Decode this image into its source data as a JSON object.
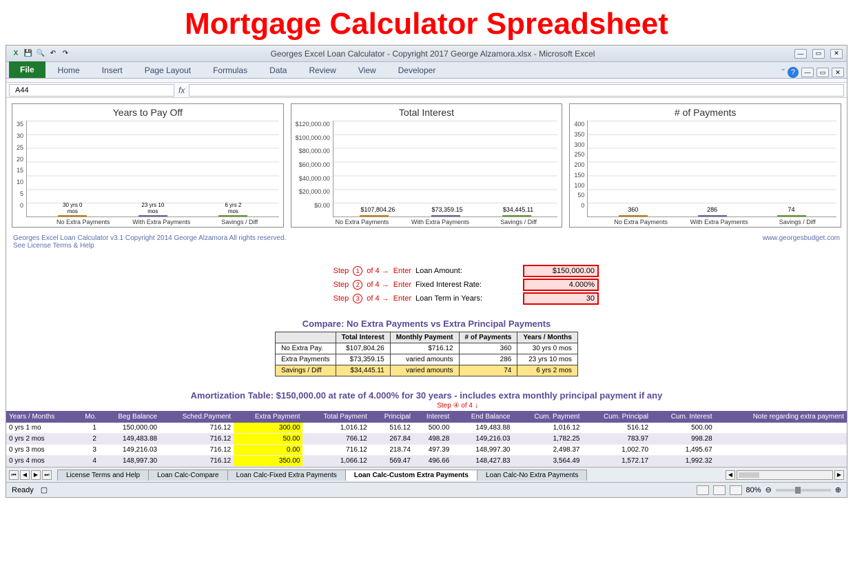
{
  "page_heading": "Mortgage Calculator Spreadsheet",
  "window_title": "Georges Excel Loan Calculator -  Copyright 2017 George Alzamora.xlsx  -  Microsoft Excel",
  "ribbon": {
    "file": "File",
    "tabs": [
      "Home",
      "Insert",
      "Page Layout",
      "Formulas",
      "Data",
      "Review",
      "View",
      "Developer"
    ]
  },
  "namebox": "A44",
  "fx": "fx",
  "credits_left": "Georges Excel Loan Calculator v3.1   Copyright 2014 George Alzamora  All rights reserved.",
  "credits_left2": "See License Terms & Help",
  "credits_right": "www.georgesbudget.com",
  "chart_data": [
    {
      "type": "bar",
      "title": "Years to Pay Off",
      "categories": [
        "No Extra Payments",
        "With Extra Payments",
        "Savings / Diff"
      ],
      "values": [
        30,
        23.83,
        6.17
      ],
      "bar_labels": [
        "30 yrs 0 mos",
        "23 yrs 10 mos",
        "6 yrs 2 mos"
      ],
      "ylim": [
        0,
        35
      ],
      "yticks": [
        "35",
        "30",
        "25",
        "20",
        "15",
        "10",
        "5",
        "0"
      ]
    },
    {
      "type": "bar",
      "title": "Total Interest",
      "categories": [
        "No Extra Payments",
        "With Extra Payments",
        "Savings / Diff"
      ],
      "values": [
        107804.26,
        73359.15,
        34445.11
      ],
      "bar_labels": [
        "$107,804.26",
        "$73,359.15",
        "$34,445.11"
      ],
      "ylim": [
        0,
        120000
      ],
      "yticks": [
        "$120,000.00",
        "$100,000.00",
        "$80,000.00",
        "$60,000.00",
        "$40,000.00",
        "$20,000.00",
        "$0.00"
      ]
    },
    {
      "type": "bar",
      "title": "# of Payments",
      "categories": [
        "No Extra Payments",
        "With Extra Payments",
        "Savings / Diff"
      ],
      "values": [
        360,
        286,
        74
      ],
      "bar_labels": [
        "360",
        "286",
        "74"
      ],
      "ylim": [
        0,
        400
      ],
      "yticks": [
        "400",
        "350",
        "300",
        "250",
        "200",
        "150",
        "100",
        "50",
        "0"
      ]
    }
  ],
  "steps": {
    "prefix": "Step",
    "of": "of 4 →",
    "enter": "Enter",
    "rows": [
      {
        "num": "1",
        "label": "Loan Amount:",
        "value": "$150,000.00"
      },
      {
        "num": "2",
        "label": "Fixed Interest Rate:",
        "value": "4.000%"
      },
      {
        "num": "3",
        "label": "Loan Term in Years:",
        "value": "30"
      }
    ],
    "step4": "Step ④ of 4 ↓"
  },
  "compare": {
    "title": "Compare: No Extra Payments vs Extra Principal Payments",
    "headers": [
      "",
      "Total Interest",
      "Monthly Payment",
      "# of Payments",
      "Years / Months"
    ],
    "rows": [
      [
        "No Extra Pay.",
        "$107,804.26",
        "$716.12",
        "360",
        "30 yrs 0 mos"
      ],
      [
        "Extra Payments",
        "$73,359.15",
        "varied amounts",
        "286",
        "23 yrs 10 mos"
      ],
      [
        "Savings / Diff",
        "$34,445.11",
        "varied amounts",
        "74",
        "6 yrs 2 mos"
      ]
    ]
  },
  "amort": {
    "title": "Amortization Table:  $150,000.00 at rate of 4.000% for 30 years - includes extra monthly principal payment if any",
    "headers": [
      "Years / Months",
      "Mo.",
      "Beg Balance",
      "Sched.Payment",
      "Extra Payment",
      "Total Payment",
      "Principal",
      "Interest",
      "End Balance",
      "Cum. Payment",
      "Cum. Principal",
      "Cum. Interest",
      "Note regarding extra payment"
    ],
    "rows": [
      [
        "0 yrs 1 mo",
        "1",
        "150,000.00",
        "716.12",
        "300.00",
        "1,016.12",
        "516.12",
        "500.00",
        "149,483.88",
        "1,016.12",
        "516.12",
        "500.00",
        ""
      ],
      [
        "0 yrs 2 mos",
        "2",
        "149,483.88",
        "716.12",
        "50.00",
        "766.12",
        "267.84",
        "498.28",
        "149,216.03",
        "1,782.25",
        "783.97",
        "998.28",
        ""
      ],
      [
        "0 yrs 3 mos",
        "3",
        "149,216.03",
        "716.12",
        "0.00",
        "716.12",
        "218.74",
        "497.39",
        "148,997.30",
        "2,498.37",
        "1,002.70",
        "1,495.67",
        ""
      ],
      [
        "0 yrs 4 mos",
        "4",
        "148,997.30",
        "716.12",
        "350.00",
        "1,066.12",
        "569.47",
        "496.66",
        "148,427.83",
        "3,564.49",
        "1,572.17",
        "1,992.32",
        ""
      ]
    ]
  },
  "sheet_tabs": [
    "License Terms and Help",
    "Loan Calc-Compare",
    "Loan Calc-Fixed Extra Payments",
    "Loan Calc-Custom Extra Payments",
    "Loan Calc-No Extra Payments"
  ],
  "active_tab": 3,
  "status": {
    "ready": "Ready",
    "zoom": "80%"
  }
}
